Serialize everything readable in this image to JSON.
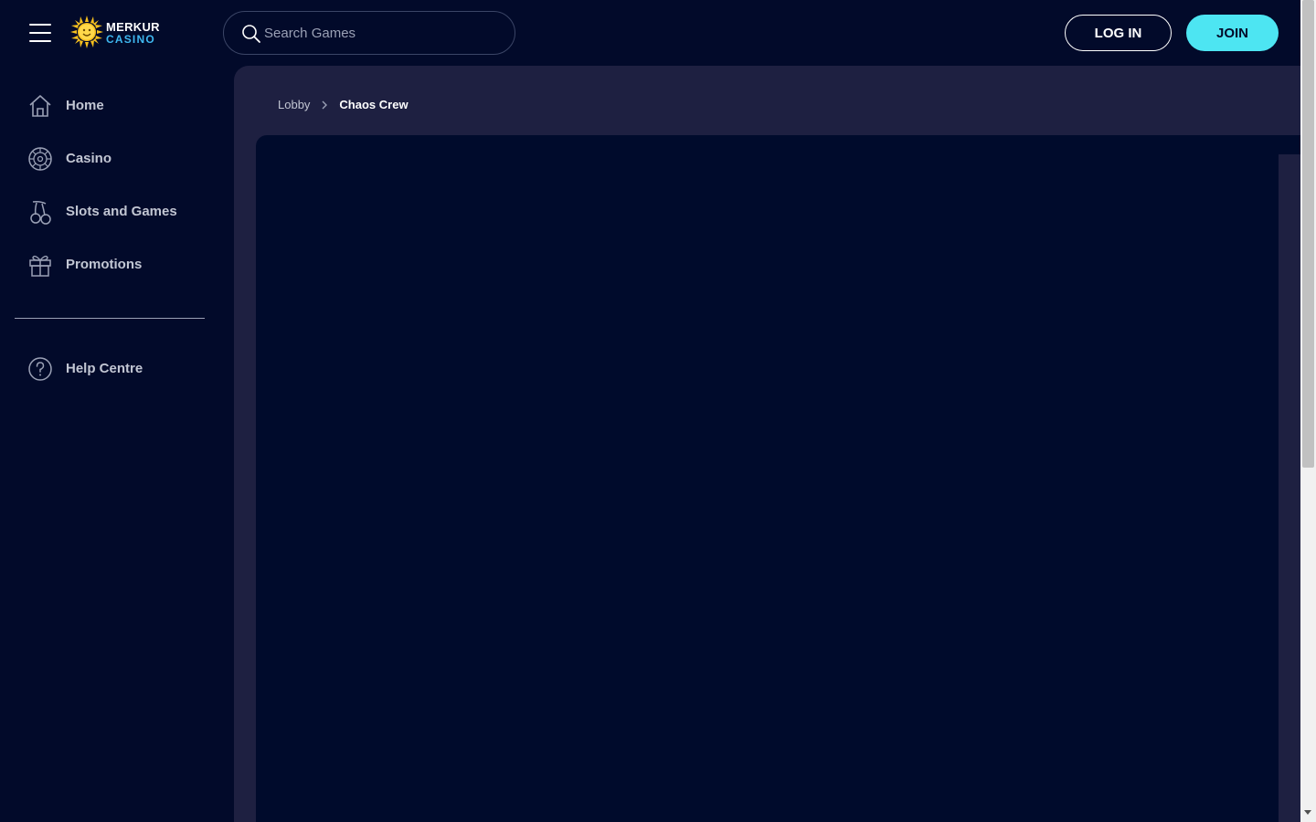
{
  "header": {
    "logo": {
      "line1": "MERKUR",
      "line2": "CASINO"
    },
    "search": {
      "placeholder": "Search Games",
      "value": ""
    },
    "login_label": "LOG IN",
    "join_label": "JOIN"
  },
  "sidebar": {
    "items": [
      {
        "label": "Home",
        "icon": "home-icon"
      },
      {
        "label": "Casino",
        "icon": "roulette-icon"
      },
      {
        "label": "Slots and Games",
        "icon": "cherries-icon"
      },
      {
        "label": "Promotions",
        "icon": "gift-icon"
      }
    ],
    "help": {
      "label": "Help Centre",
      "icon": "help-icon"
    }
  },
  "breadcrumb": {
    "items": [
      "Lobby",
      "Chaos Crew"
    ]
  },
  "colors": {
    "background": "#020a2a",
    "main_panel": "#1e2041",
    "game_frame": "#000b2c",
    "accent": "#4de5f2",
    "logo_sun": "#f6c01e",
    "logo_blue": "#3fb8f0"
  }
}
